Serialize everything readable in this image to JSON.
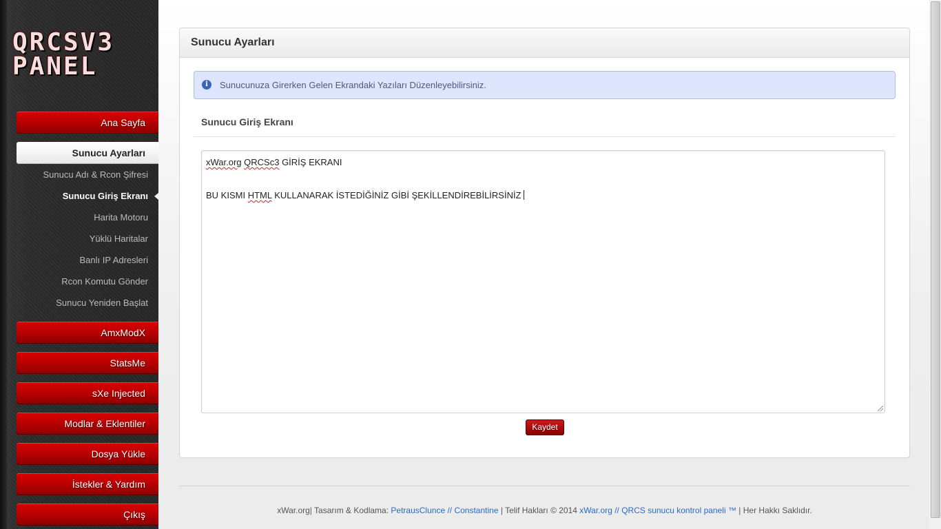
{
  "logo": {
    "line1": "QRCSV3",
    "line2": "PANEL"
  },
  "sidebar": {
    "main_items": [
      {
        "label": "Ana Sayfa"
      },
      {
        "label": "Sunucu Ayarları",
        "active": true
      },
      {
        "label": "AmxModX"
      },
      {
        "label": "StatsMe"
      },
      {
        "label": "sXe Injected"
      },
      {
        "label": "Modlar & Eklentiler"
      },
      {
        "label": "Dosya Yükle"
      },
      {
        "label": "İstekler & Yardım"
      },
      {
        "label": "Çıkış"
      }
    ],
    "sub_items": [
      {
        "label": "Sunucu Adı & Rcon Şifresi"
      },
      {
        "label": "Sunucu Giriş Ekranı",
        "active": true
      },
      {
        "label": "Harita Motoru"
      },
      {
        "label": "Yüklü Haritalar"
      },
      {
        "label": "Banlı IP Adresleri"
      },
      {
        "label": "Rcon Komutu Gönder"
      },
      {
        "label": "Sunucu Yeniden Başlat"
      }
    ]
  },
  "panel": {
    "title": "Sunucu Ayarları",
    "alert": {
      "icon": "info-icon",
      "text": "Sunucunuza Girerken Gelen Ekrandaki Yazıları Düzenleyebilirsiniz."
    },
    "section_title": "Sunucu Giriş Ekranı",
    "editor": {
      "line1": {
        "word1": "xWar.org",
        "word2": "QRCSc3",
        "rest": " GİRİŞ EKRANI"
      },
      "line2": {
        "before": "BU KISMI ",
        "word": "HTML",
        "after": " KULLANARAK İSTEDİĞİNİZ GİBİ ŞEKİLLENDİREBİLİRSİNİZ"
      }
    },
    "save_label": "Kaydet"
  },
  "footer": {
    "prefix": "xWar.org| Tasarım & Kodlama: ",
    "author_link": "PetrausClunce // Constantine",
    "middle": " | Telif Hakları © 2014 ",
    "site_link": "xWar.org // QRCS sunucu kontrol paneli ™",
    "suffix": " | Her Hakkı Saklıdır."
  },
  "colors": {
    "accent_red": "#c00000",
    "link_blue": "#2a6bc4",
    "alert_bg": "#dde6fd"
  }
}
